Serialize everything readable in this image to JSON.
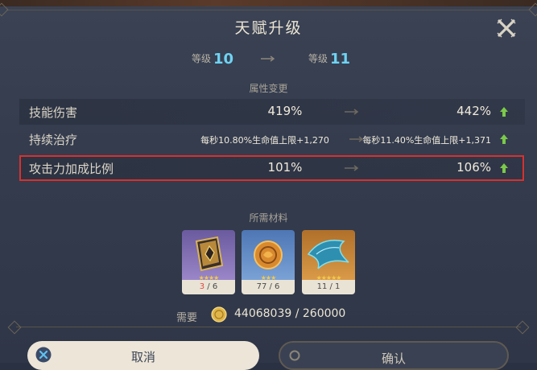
{
  "dialog": {
    "title": "天赋升级",
    "close_icon": "close-icon"
  },
  "levels": {
    "from_label": "等级",
    "from_value": "10",
    "to_label": "等级",
    "to_value": "11"
  },
  "attributes": {
    "header": "属性变更",
    "rows": [
      {
        "name": "技能伤害",
        "current": "419%",
        "next": "442%"
      },
      {
        "name": "持续治疗",
        "current": "每秒10.80%生命值上限+1,270",
        "next": "每秒11.40%生命值上限+1,371"
      },
      {
        "name": "攻击力加成比例",
        "current": "101%",
        "next": "106%"
      }
    ]
  },
  "materials": {
    "header": "所需材料",
    "items": [
      {
        "icon": "talent-book-icon",
        "have": "3",
        "need": "6",
        "stars": "★★★★"
      },
      {
        "icon": "coin-disc-icon",
        "have": "77",
        "need": "6",
        "stars": "★★★"
      },
      {
        "icon": "crystal-wing-icon",
        "have": "11",
        "need": "1",
        "stars": "★★★★★"
      }
    ]
  },
  "cost": {
    "label": "需要",
    "have": "44068039",
    "need": "260000",
    "icon": "mora-coin-icon"
  },
  "buttons": {
    "cancel": "取消",
    "confirm": "确认"
  },
  "colors": {
    "level_accent": "#6fd3f2",
    "up_arrow": "#7cc94a",
    "insufficient": "#e24a3c",
    "highlight_box": "#d8312f"
  }
}
